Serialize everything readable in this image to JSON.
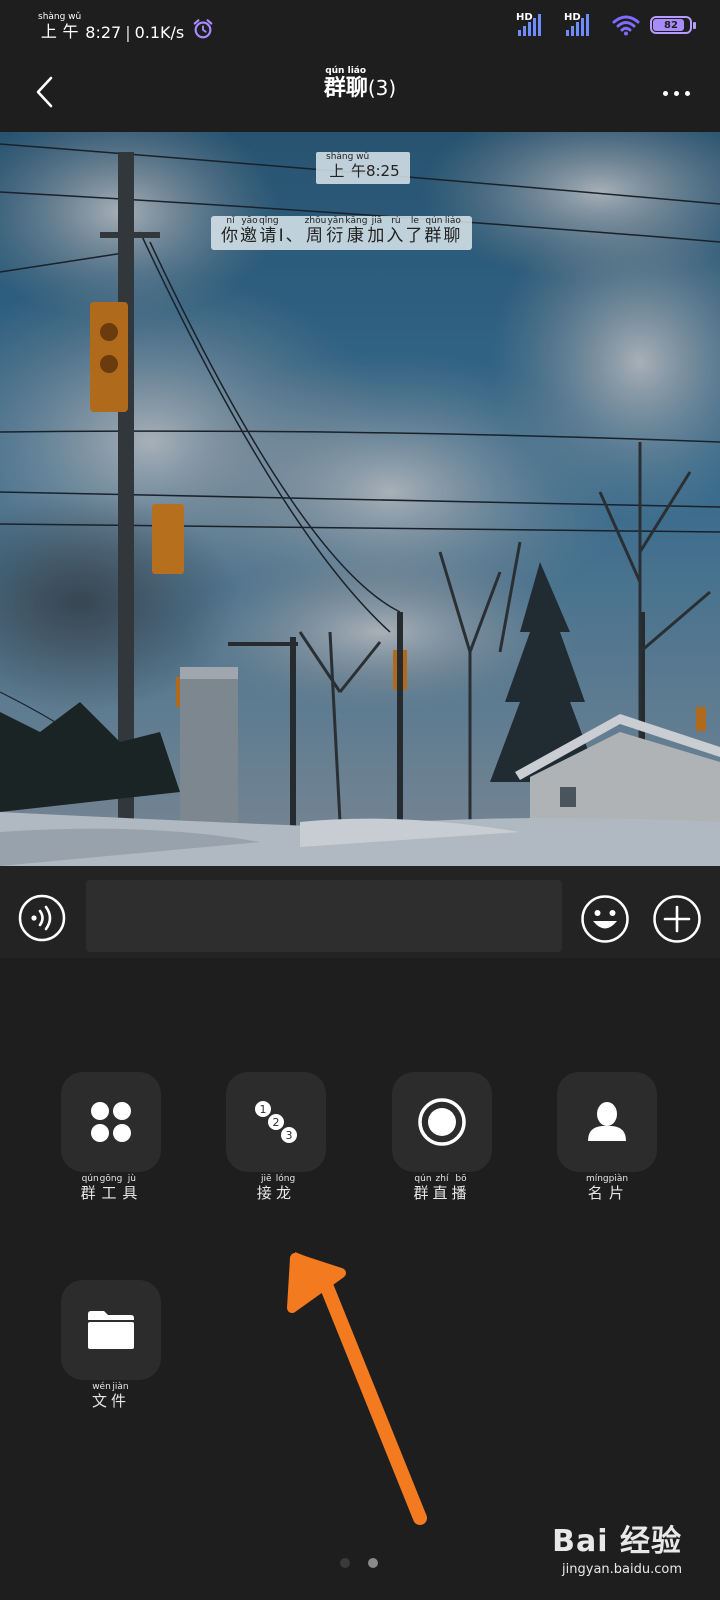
{
  "status_bar": {
    "time_ruby": {
      "base": "上午",
      "reading": "shàng wǔ"
    },
    "time": "8:27",
    "speed": "0.1K/s",
    "signal_1_label": "HD",
    "signal_2_label": "HD",
    "battery": "82",
    "icons": [
      "alarm-clock-icon",
      "signal-icon",
      "signal-icon",
      "wifi-icon",
      "battery-icon"
    ]
  },
  "nav": {
    "title_ruby": [
      {
        "base": "群",
        "reading": "qún"
      },
      {
        "base": "聊",
        "reading": "liáo"
      }
    ],
    "title_count": "(3)",
    "icons": {
      "back": "chevron-left-icon",
      "more": "more-dots-icon"
    }
  },
  "chat": {
    "timestamp_ruby": {
      "base": "上午",
      "reading": "shàng wǔ"
    },
    "timestamp": "8:25",
    "system_message_ruby": [
      {
        "base": "你",
        "reading": "nǐ"
      },
      {
        "base": "邀",
        "reading": "yāo"
      },
      {
        "base": "请",
        "reading": "qǐng"
      },
      {
        "base": "I、",
        "reading": ""
      },
      {
        "base": "周",
        "reading": "zhōu"
      },
      {
        "base": "衍",
        "reading": "yǎn"
      },
      {
        "base": "康",
        "reading": "kāng"
      },
      {
        "base": "加",
        "reading": "jiā"
      },
      {
        "base": "入",
        "reading": "rù"
      },
      {
        "base": "了",
        "reading": "le"
      },
      {
        "base": "群",
        "reading": "qún"
      },
      {
        "base": "聊",
        "reading": "liáo"
      }
    ]
  },
  "input_bar": {
    "message_value": "",
    "icons": {
      "voice": "voice-icon",
      "emoji": "emoji-icon",
      "more": "plus-icon"
    }
  },
  "tools": [
    {
      "id": "group-tools",
      "icon": "grid-dots-icon",
      "ruby": [
        {
          "base": "群",
          "reading": "qún"
        },
        {
          "base": "工",
          "reading": "gōng"
        },
        {
          "base": "具",
          "reading": "jù"
        }
      ]
    },
    {
      "id": "solitaire",
      "icon": "numbered-circles-icon",
      "icon_numbers": [
        "1",
        "2",
        "3"
      ],
      "ruby": [
        {
          "base": "接",
          "reading": "jiē"
        },
        {
          "base": "龙",
          "reading": "lóng"
        }
      ]
    },
    {
      "id": "group-live",
      "icon": "record-icon",
      "ruby": [
        {
          "base": "群",
          "reading": "qún"
        },
        {
          "base": "直",
          "reading": "zhí"
        },
        {
          "base": "播",
          "reading": "bō"
        }
      ]
    },
    {
      "id": "business-card",
      "icon": "person-icon",
      "ruby": [
        {
          "base": "名",
          "reading": "míng"
        },
        {
          "base": "片",
          "reading": "piàn"
        }
      ]
    },
    {
      "id": "file",
      "icon": "folder-icon",
      "ruby": [
        {
          "base": "文",
          "reading": "wén"
        },
        {
          "base": "件",
          "reading": "jiàn"
        }
      ]
    }
  ],
  "pager": {
    "page_count": 2,
    "active_page": 2
  },
  "annotation": {
    "type": "arrow",
    "color": "#f47a20"
  },
  "watermark": {
    "logo": "Bai  经验",
    "url": "jingyan.baidu.com"
  },
  "colors": {
    "background": "#1e1e1e",
    "tile": "#2c2c2c",
    "signal": "#6f8cff",
    "battery": "#a78bff",
    "arrow": "#f47a20"
  }
}
